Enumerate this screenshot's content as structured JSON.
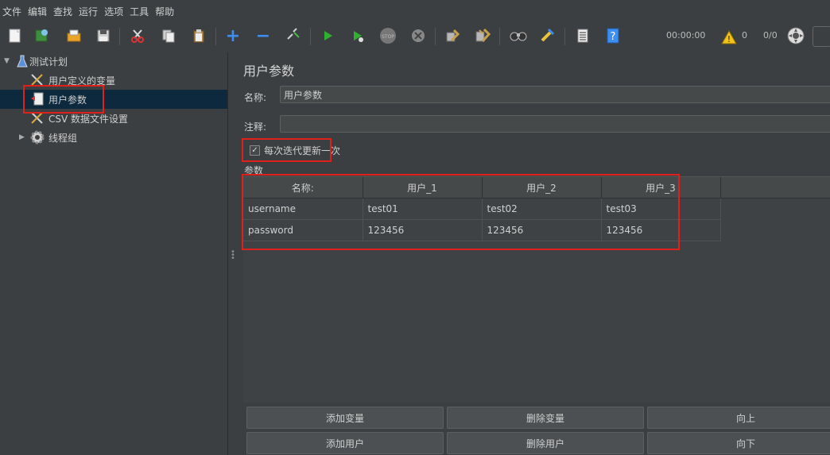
{
  "menu": [
    "文件",
    "编辑",
    "查找",
    "运行",
    "选项",
    "工具",
    "帮助"
  ],
  "toolbar": {
    "icons": [
      "new-icon",
      "templates-icon",
      "open-icon",
      "save-icon",
      "cut-icon",
      "copy-icon",
      "paste-icon",
      "expand-icon",
      "collapse-icon",
      "toggle-icon",
      "start-icon",
      "start-no-pause-icon",
      "stop-icon",
      "shutdown-icon",
      "clear-icon",
      "clear-all-icon",
      "search-icon",
      "reset-search-icon",
      "function-helper-icon",
      "help-icon"
    ],
    "timer": "00:00:00",
    "warnings": "0",
    "threads": "0/0",
    "stop_label": "STOP"
  },
  "tree": {
    "items": [
      {
        "label": "测试计划",
        "icon": "flask-icon"
      },
      {
        "label": "用户定义的变量",
        "icon": "tools-icon"
      },
      {
        "label": "用户参数",
        "icon": "preprocessor-icon"
      },
      {
        "label": "CSV 数据文件设置",
        "icon": "tools-icon"
      },
      {
        "label": "线程组",
        "icon": "gear-icon"
      }
    ]
  },
  "panel": {
    "title": "用户参数",
    "name_label": "名称:",
    "name_value": "用户参数",
    "comment_label": "注释:",
    "comment_value": "",
    "checkbox_label": "每次迭代更新一次",
    "checkbox_checked": true,
    "params_label": "参数"
  },
  "table": {
    "headers": [
      "名称:",
      "用户_1",
      "用户_2",
      "用户_3"
    ],
    "rows": [
      [
        "username",
        "test01",
        "test02",
        "test03"
      ],
      [
        "password",
        "123456",
        "123456",
        "123456"
      ]
    ]
  },
  "buttons": {
    "add_variable": "添加变量",
    "delete_variable": "删除变量",
    "move_up": "向上",
    "add_user": "添加用户",
    "delete_user": "删除用户",
    "move_down": "向下"
  },
  "colors": {
    "background": "#3c3f41",
    "selection": "#0d293e",
    "highlight": "#e0201b"
  }
}
